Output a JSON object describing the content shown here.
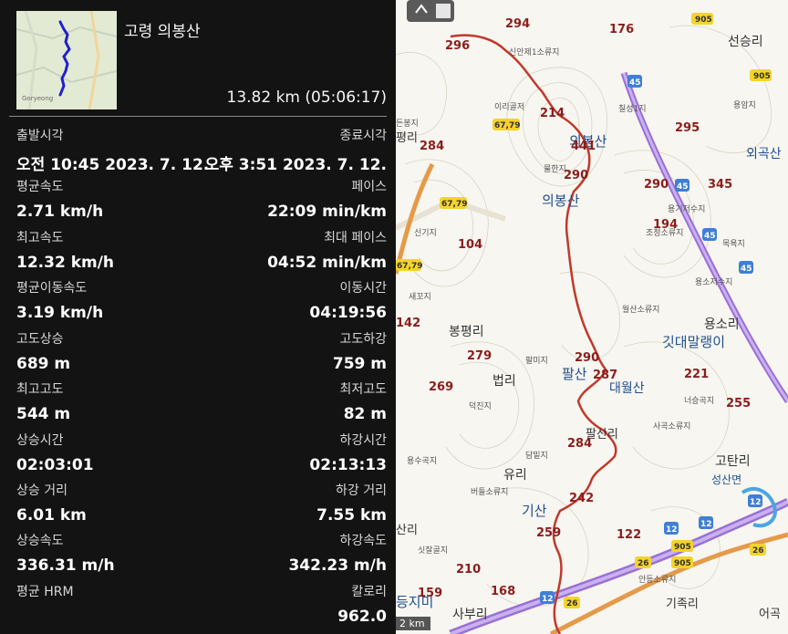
{
  "header": {
    "title": "고령 의봉산",
    "summary": "13.82 km (05:06:17)"
  },
  "stats": [
    {
      "left_label": "출발시각",
      "left_value": "오전 10:45 2023. 7. 12.",
      "right_label": "종료시각",
      "right_value": "오후 3:51 2023. 7. 12."
    },
    {
      "left_label": "평균속도",
      "left_value": "2.71 km/h",
      "right_label": "페이스",
      "right_value": "22:09 min/km"
    },
    {
      "left_label": "최고속도",
      "left_value": "12.32 km/h",
      "right_label": "최대 페이스",
      "right_value": "04:52 min/km"
    },
    {
      "left_label": "평균이동속도",
      "left_value": "3.19 km/h",
      "right_label": "이동시간",
      "right_value": "04:19:56"
    },
    {
      "left_label": "고도상승",
      "left_value": "689 m",
      "right_label": "고도하강",
      "right_value": "759 m"
    },
    {
      "left_label": "최고고도",
      "left_value": "544 m",
      "right_label": "최저고도",
      "right_value": "82 m"
    },
    {
      "left_label": "상승시간",
      "left_value": "02:03:01",
      "right_label": "하강시간",
      "right_value": "02:13:13"
    },
    {
      "left_label": "상승 거리",
      "left_value": "6.01 km",
      "right_label": "하강 거리",
      "right_value": "7.55 km"
    },
    {
      "left_label": "상승속도",
      "left_value": "336.31 m/h",
      "right_label": "하강속도",
      "right_value": "342.23 m/h"
    },
    {
      "left_label": "평균 HRM",
      "left_value": "",
      "right_label": "칼로리",
      "right_value": "962.0"
    }
  ],
  "thumbnail": {
    "label": "Goryeong"
  },
  "map": {
    "scale_label": "2 km",
    "place_names": [
      {
        "text": "의봉산",
        "color": "#1f4f8f"
      },
      {
        "text": "팔산",
        "color": "#1f4f8f"
      },
      {
        "text": "대월산",
        "color": "#1f4f8f"
      },
      {
        "text": "깃대말랭이",
        "color": "#1f4f8f"
      },
      {
        "text": "기산",
        "color": "#1f4f8f"
      },
      {
        "text": "외곡산",
        "color": "#1f4f8f"
      },
      {
        "text": "봉평리",
        "color": "#333333"
      },
      {
        "text": "법리",
        "color": "#333333"
      },
      {
        "text": "유리",
        "color": "#333333"
      },
      {
        "text": "팔산리",
        "color": "#333333"
      },
      {
        "text": "용소리",
        "color": "#333333"
      },
      {
        "text": "고탄리",
        "color": "#333333"
      },
      {
        "text": "선승리",
        "color": "#333333"
      },
      {
        "text": "사부리",
        "color": "#333333"
      },
      {
        "text": "기족리",
        "color": "#333333"
      },
      {
        "text": "성산면",
        "color": "#1f4f8f"
      },
      {
        "text": "등지미",
        "color": "#1f4f8f"
      },
      {
        "text": "평리",
        "color": "#333333"
      },
      {
        "text": "어곡",
        "color": "#333333"
      },
      {
        "text": "산리",
        "color": "#333333"
      },
      {
        "text": "신안제1소류지",
        "color": "#555555"
      },
      {
        "text": "이리골저",
        "color": "#555555"
      },
      {
        "text": "칠성1지",
        "color": "#555555"
      },
      {
        "text": "물한지",
        "color": "#555555"
      },
      {
        "text": "신기지",
        "color": "#555555"
      },
      {
        "text": "새꼬지",
        "color": "#555555"
      },
      {
        "text": "월산소류지",
        "color": "#555555"
      },
      {
        "text": "용기저수지",
        "color": "#555555"
      },
      {
        "text": "조정소류지",
        "color": "#555555"
      },
      {
        "text": "목욕지",
        "color": "#555555"
      },
      {
        "text": "용소저수지",
        "color": "#555555"
      },
      {
        "text": "용암지",
        "color": "#555555"
      },
      {
        "text": "팔미지",
        "color": "#555555"
      },
      {
        "text": "덕진지",
        "color": "#555555"
      },
      {
        "text": "너승곡지",
        "color": "#555555"
      },
      {
        "text": "사곡소류지",
        "color": "#555555"
      },
      {
        "text": "담밑지",
        "color": "#555555"
      },
      {
        "text": "용수곡지",
        "color": "#555555"
      },
      {
        "text": "버들소류지",
        "color": "#555555"
      },
      {
        "text": "싯잘골지",
        "color": "#555555"
      },
      {
        "text": "안등소류지",
        "color": "#555555"
      },
      {
        "text": "든봉지",
        "color": "#555555"
      }
    ],
    "elevations": [
      "294",
      "296",
      "176",
      "214",
      "441",
      "290",
      "284",
      "295",
      "290",
      "345",
      "194",
      "104",
      "142",
      "279",
      "290",
      "287",
      "221",
      "255",
      "269",
      "284",
      "242",
      "259",
      "122",
      "210",
      "168",
      "159"
    ],
    "road_shields": [
      "905",
      "905",
      "67,79",
      "67,79",
      "67,79",
      "45",
      "45",
      "45",
      "45",
      "12",
      "12",
      "12",
      "12",
      "905",
      "905",
      "26",
      "26",
      "26"
    ],
    "route_color": "#c0392b"
  }
}
